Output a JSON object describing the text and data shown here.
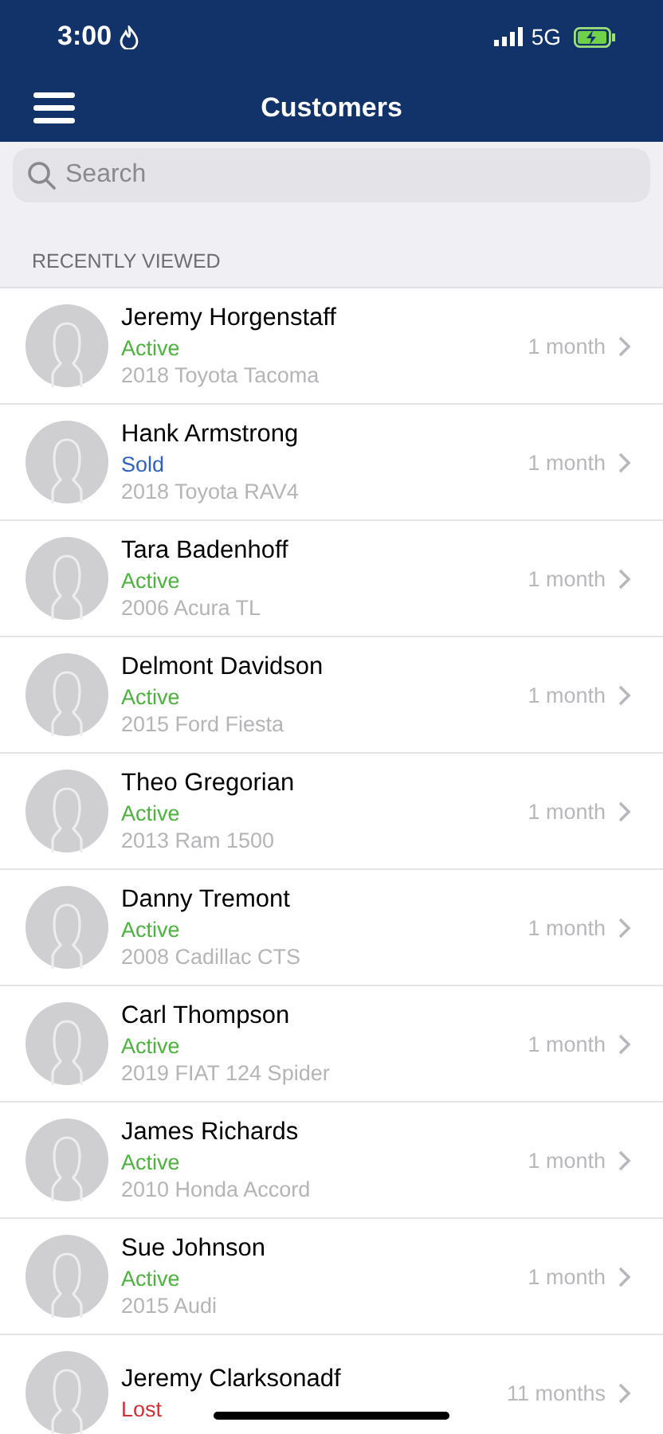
{
  "status_bar": {
    "time": "3:00",
    "network": "5G"
  },
  "nav": {
    "title": "Customers"
  },
  "search": {
    "placeholder": "Search"
  },
  "section": {
    "title": "RECENTLY VIEWED"
  },
  "customers": [
    {
      "name": "Jeremy Horgenstaff",
      "status": "Active",
      "color": "#4cb33e",
      "vehicle": "2018 Toyota Tacoma",
      "time": "1 month"
    },
    {
      "name": "Hank Armstrong",
      "status": "Sold",
      "color": "#2f62c4",
      "vehicle": "2018 Toyota RAV4",
      "time": "1 month"
    },
    {
      "name": "Tara Badenhoff",
      "status": "Active",
      "color": "#4cb33e",
      "vehicle": "2006 Acura TL",
      "time": "1 month"
    },
    {
      "name": "Delmont Davidson",
      "status": "Active",
      "color": "#4cb33e",
      "vehicle": "2015 Ford Fiesta",
      "time": "1 month"
    },
    {
      "name": "Theo Gregorian",
      "status": "Active",
      "color": "#4cb33e",
      "vehicle": "2013 Ram 1500",
      "time": "1 month"
    },
    {
      "name": "Danny Tremont",
      "status": "Active",
      "color": "#4cb33e",
      "vehicle": "2008 Cadillac CTS",
      "time": "1 month"
    },
    {
      "name": "Carl Thompson",
      "status": "Active",
      "color": "#4cb33e",
      "vehicle": "2019 FIAT 124 Spider",
      "time": "1 month"
    },
    {
      "name": "James Richards",
      "status": "Active",
      "color": "#4cb33e",
      "vehicle": "2010 Honda Accord",
      "time": "1 month"
    },
    {
      "name": "Sue Johnson",
      "status": "Active",
      "color": "#4cb33e",
      "vehicle": "2015 Audi",
      "time": "1 month"
    },
    {
      "name": "Jeremy Clarksonadf",
      "status": "Lost",
      "color": "#d0303a",
      "time": "11 months"
    }
  ]
}
